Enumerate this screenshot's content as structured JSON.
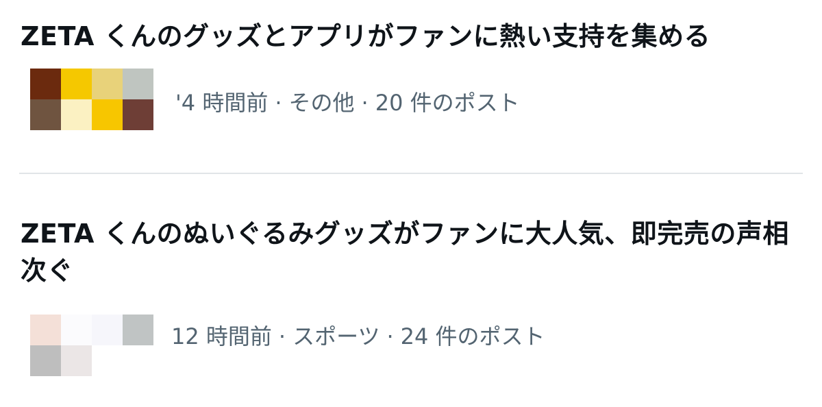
{
  "trends": [
    {
      "title": "ZETA くんのグッズとアプリがファンに熱い支持を集める",
      "time": "'4 時間前",
      "category": "その他",
      "posts": "20 件のポスト",
      "separator": "·",
      "thumbnail_colors": [
        "#6b2a0e",
        "#f5c800",
        "#e8d27a",
        "#bfc5c0",
        "#6f5440",
        "#fbf1c2",
        "#f7c600",
        "#6e3e36"
      ]
    },
    {
      "title": "ZETA くんのぬいぐるみグッズがファンに大人気、即完売の声相次ぐ",
      "time": "12 時間前",
      "category": "スポーツ",
      "posts": "24 件のポスト",
      "separator": "·",
      "thumbnail_colors": [
        "#f4e0d8",
        "#fbfbfd",
        "#f6f6fb",
        "#c0c4c4",
        "#bebebe",
        "#ebe6e6",
        "#ffffff",
        "#ffffff"
      ]
    }
  ]
}
